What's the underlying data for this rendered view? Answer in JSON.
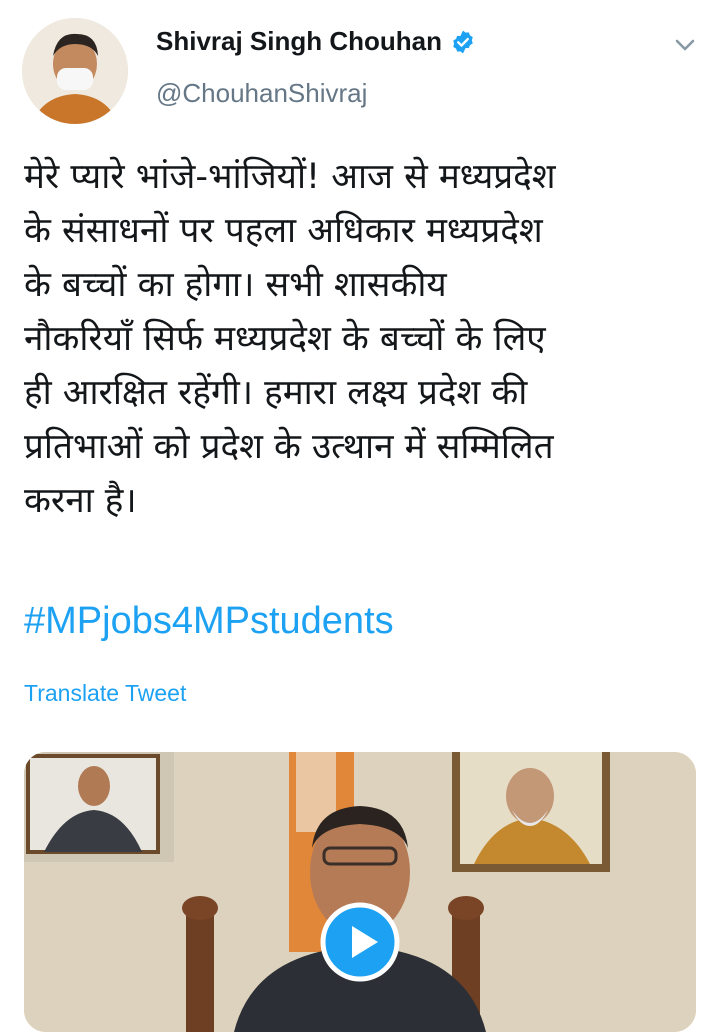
{
  "user": {
    "display_name": "Shivraj Singh Chouhan",
    "handle": "@ChouhanShivraj",
    "verified": true
  },
  "tweet": {
    "lines": [
      "मेरे प्यारे भांजे-भांजियों! आज से मध्यप्रदेश",
      "के संसाधनों पर पहला अधिकार मध्यप्रदेश",
      "के बच्चों का होगा। सभी शासकीय",
      "नौकरियाँ सिर्फ मध्यप्रदेश के बच्चों के लिए",
      "ही आरक्षित रहेंगी। हमारा लक्ष्य प्रदेश की",
      "प्रतिभाओं को प्रदेश के उत्थान में सम्मिलित",
      "करना है।"
    ],
    "hashtag": "#MPjobs4MPstudents",
    "translate_label": "Translate Tweet"
  },
  "icons": {
    "verified": "verified-badge-icon",
    "menu": "chevron-down-icon",
    "play": "play-icon"
  },
  "colors": {
    "link": "#1da1f2",
    "handle": "#657786",
    "text": "#14171a"
  }
}
